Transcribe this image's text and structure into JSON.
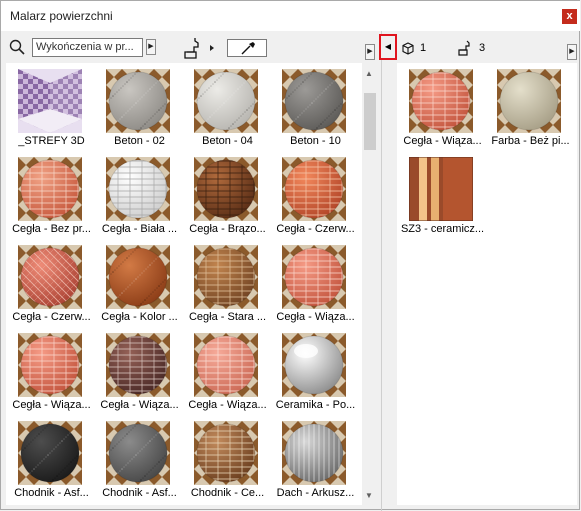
{
  "window": {
    "title": "Malarz powierzchni",
    "close_label": "x"
  },
  "toolbar": {
    "search_value": "Wykończenia w pr...",
    "model_count": "1",
    "brush_count": "3"
  },
  "icons": {
    "search": "search-icon",
    "close": "close-icon",
    "brush": "paint-brush-icon",
    "eyedropper": "eyedropper-icon",
    "cube": "cube-icon",
    "collapse": "triangle-left-icon",
    "expand": "triangle-right-icon"
  },
  "left_materials": [
    {
      "label": "_STREFY 3D",
      "type": "zones"
    },
    {
      "label": "Beton - 02",
      "type": "concrete_mid"
    },
    {
      "label": "Beton - 04",
      "type": "concrete_light"
    },
    {
      "label": "Beton - 10",
      "type": "concrete_dark"
    },
    {
      "label": "Cegła - Bez pr...",
      "type": "brick_orange"
    },
    {
      "label": "Cegła - Biała ...",
      "type": "brick_white"
    },
    {
      "label": "Cegła - Brązo...",
      "type": "brick_brown"
    },
    {
      "label": "Cegła - Czerw...",
      "type": "brick_red"
    },
    {
      "label": "Cegła - Czerw...",
      "type": "brick_herringbone"
    },
    {
      "label": "Cegła - Kolor ...",
      "type": "brick_rust"
    },
    {
      "label": "Cegła - Stara ...",
      "type": "brick_old"
    },
    {
      "label": "Cegła - Wiąza...",
      "type": "brick_salmon"
    },
    {
      "label": "Cegła - Wiąza...",
      "type": "brick_salmon"
    },
    {
      "label": "Cegła - Wiąza...",
      "type": "brick_dark"
    },
    {
      "label": "Cegła - Wiąza...",
      "type": "brick_pink"
    },
    {
      "label": "Ceramika - Po...",
      "type": "ceramic"
    },
    {
      "label": "Chodnik - Asf...",
      "type": "asphalt_dark"
    },
    {
      "label": "Chodnik - Asf...",
      "type": "asphalt_grey"
    },
    {
      "label": "Chodnik - Ce...",
      "type": "paving"
    },
    {
      "label": "Dach - Arkusz...",
      "type": "roof_sheet"
    }
  ],
  "right_materials": [
    {
      "label": "Cegła - Wiąza...",
      "type": "brick_salmon"
    },
    {
      "label": "Farba - Beż pi...",
      "type": "paint_beige"
    },
    {
      "label": "SZ3 - ceramicz...",
      "type": "ceramic_sz3"
    }
  ],
  "colors": {
    "close_red": "#c42b1c",
    "highlight_red": "#e0141e",
    "tile_bg_dark": "#8b5a2b",
    "tile_bg_light": "#d8c9b0"
  }
}
